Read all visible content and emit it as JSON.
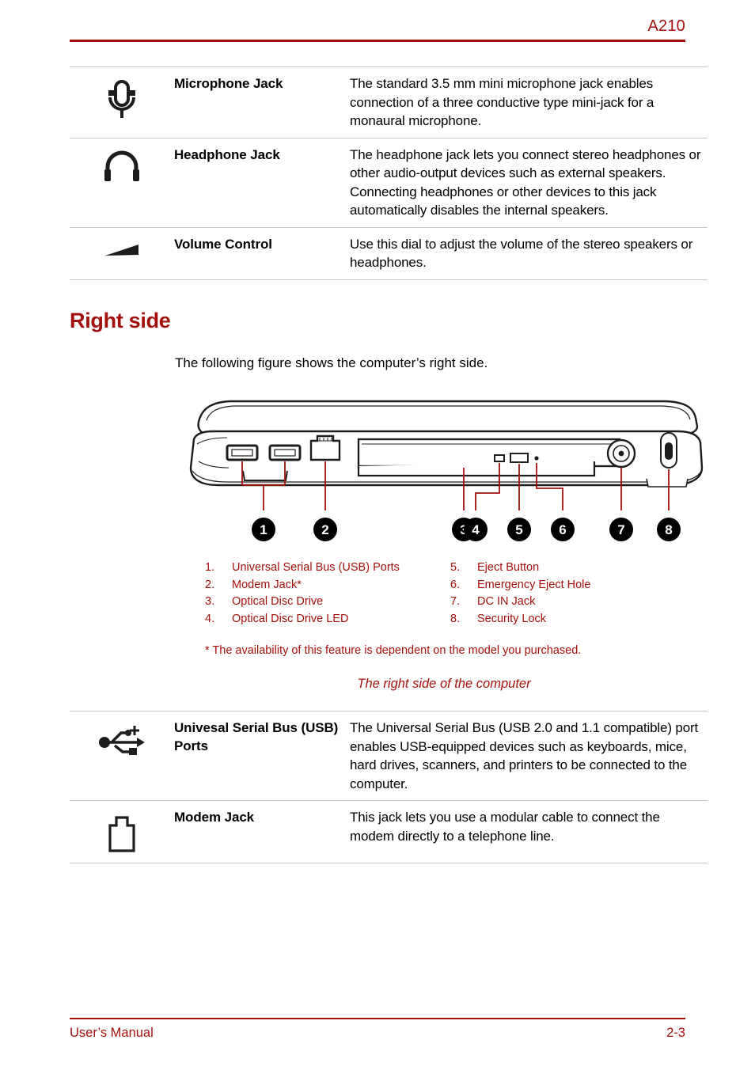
{
  "header": {
    "title": "A210"
  },
  "top_table": {
    "rows": [
      {
        "icon": "microphone-icon",
        "term": "Microphone Jack",
        "description": "The standard 3.5 mm mini microphone jack enables connection of a three conductive type mini-jack for a monaural microphone."
      },
      {
        "icon": "headphone-icon",
        "term": "Headphone Jack",
        "description": "The headphone jack lets you connect stereo headphones or other audio-output devices such as external speakers. Connecting headphones or other devices to this jack automatically disables the internal speakers."
      },
      {
        "icon": "volume-control-icon",
        "term": "Volume Control",
        "description": "Use this dial to adjust the volume of the stereo speakers or headphones."
      }
    ]
  },
  "section": {
    "heading": "Right side",
    "intro": "The following figure shows the computer’s right side."
  },
  "figure": {
    "callouts": [
      "1",
      "2",
      "3",
      "4",
      "5",
      "6",
      "7",
      "8"
    ],
    "legend_left": [
      {
        "num": "1.",
        "label": "Universal Serial Bus (USB) Ports"
      },
      {
        "num": "2.",
        "label": "Modem Jack*"
      },
      {
        "num": "3.",
        "label": "Optical Disc Drive"
      },
      {
        "num": "4.",
        "label": "Optical Disc Drive LED"
      }
    ],
    "legend_right": [
      {
        "num": "5.",
        "label": "Eject Button"
      },
      {
        "num": "6.",
        "label": "Emergency Eject Hole"
      },
      {
        "num": "7.",
        "label": "DC IN Jack"
      },
      {
        "num": "8.",
        "label": "Security Lock"
      }
    ],
    "note": "* The availability of this feature is dependent on the model you purchased.",
    "caption": "The right side of the computer"
  },
  "bottom_table": {
    "rows": [
      {
        "icon": "usb-icon",
        "term": "Univesal Serial Bus (USB) Ports",
        "description": "The Universal Serial Bus (USB 2.0 and 1.1 compatible) port enables USB-equipped devices such as keyboards, mice, hard drives, scanners, and printers to be connected to the computer."
      },
      {
        "icon": "modem-jack-icon",
        "term": "Modem Jack",
        "description": "This jack lets you use a modular cable to connect the modem directly to a telephone line."
      }
    ]
  },
  "footer": {
    "left": "User’s Manual",
    "right": "2-3"
  },
  "colors": {
    "accent_red": "#a3100c",
    "rule_gray": "#c9c9c9",
    "text_black": "#000000"
  }
}
